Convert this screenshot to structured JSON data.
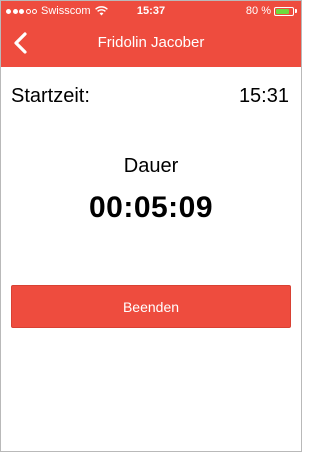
{
  "status_bar": {
    "carrier": "Swisscom",
    "time": "15:37",
    "battery": "80 %",
    "battery_level": 0.8,
    "battery_color": "#6ddb3c",
    "signal_icon": "signal-dots-icon",
    "wifi_icon": "wifi-icon"
  },
  "nav": {
    "title": "Fridolin Jacober",
    "back_icon": "chevron-left-icon"
  },
  "details": {
    "start_label": "Startzeit:",
    "start_value": "15:31",
    "duration_label": "Dauer",
    "duration_value": "00:05:09"
  },
  "actions": {
    "end_label": "Beenden"
  },
  "colors": {
    "accent": "#ee4c3e",
    "text": "#000000",
    "background": "#ffffff"
  }
}
